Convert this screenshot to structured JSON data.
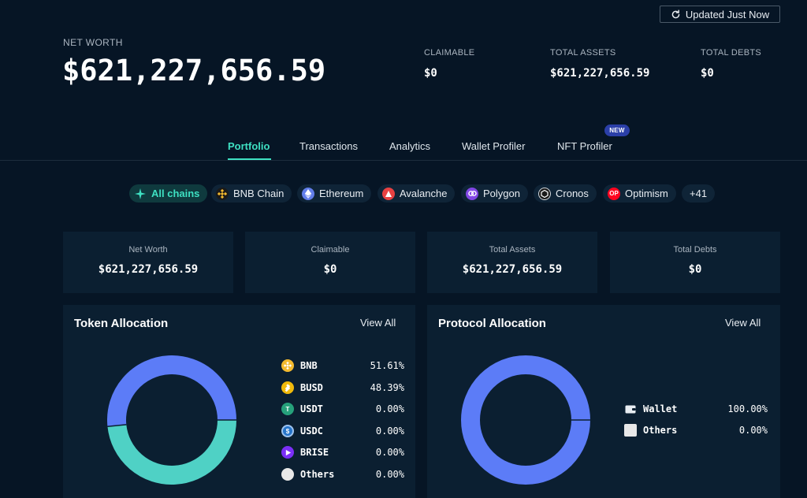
{
  "header": {
    "update_label": "Updated Just Now",
    "net_worth_label": "NET WORTH",
    "net_worth_value": "$621,227,656.59",
    "stats": [
      {
        "label": "CLAIMABLE",
        "value": "$0"
      },
      {
        "label": "TOTAL ASSETS",
        "value": "$621,227,656.59"
      },
      {
        "label": "TOTAL DEBTS",
        "value": "$0"
      }
    ]
  },
  "tabs": [
    {
      "label": "Portfolio",
      "active": true
    },
    {
      "label": "Transactions"
    },
    {
      "label": "Analytics"
    },
    {
      "label": "Wallet Profiler"
    },
    {
      "label": "NFT Profiler",
      "badge": "NEW"
    }
  ],
  "chains": [
    {
      "label": "All chains",
      "icon": "sparkle-icon",
      "active": true
    },
    {
      "label": "BNB Chain",
      "icon": "bnb-icon",
      "color": "#f3ba2f"
    },
    {
      "label": "Ethereum",
      "icon": "ethereum-icon",
      "color": "#627eea"
    },
    {
      "label": "Avalanche",
      "icon": "avalanche-icon",
      "color": "#e84142"
    },
    {
      "label": "Polygon",
      "icon": "polygon-icon",
      "color": "#8247e5"
    },
    {
      "label": "Cronos",
      "icon": "cronos-icon",
      "color": "#ffffff"
    },
    {
      "label": "Optimism",
      "icon": "optimism-icon",
      "color": "#ff0420",
      "icon_text": "OP"
    },
    {
      "label": "+41"
    }
  ],
  "cards": [
    {
      "label": "Net Worth",
      "value": "$621,227,656.59"
    },
    {
      "label": "Claimable",
      "value": "$0"
    },
    {
      "label": "Total Assets",
      "value": "$621,227,656.59"
    },
    {
      "label": "Total Debts",
      "value": "$0"
    }
  ],
  "token_allocation": {
    "title": "Token Allocation",
    "view_all": "View All",
    "items": [
      {
        "name": "BNB",
        "pct": "51.61%",
        "value": 51.61,
        "color": "#5c7cf7",
        "icon": "bnb-icon",
        "icon_color": "#f3ba2f"
      },
      {
        "name": "BUSD",
        "pct": "48.39%",
        "value": 48.39,
        "color": "#4fd1c5",
        "icon": "busd-icon",
        "icon_color": "#f0b90b"
      },
      {
        "name": "USDT",
        "pct": "0.00%",
        "value": 0,
        "icon": "usdt-icon",
        "icon_color": "#26a17b",
        "icon_text": "T"
      },
      {
        "name": "USDC",
        "pct": "0.00%",
        "value": 0,
        "icon": "usdc-icon",
        "icon_color": "#2775ca",
        "icon_text": "$"
      },
      {
        "name": "BRISE",
        "pct": "0.00%",
        "value": 0,
        "icon": "brise-icon",
        "icon_color": "#7b2ff7"
      },
      {
        "name": "Others",
        "pct": "0.00%",
        "value": 0,
        "icon": "others-icon",
        "icon_color": "#e8e8e8"
      }
    ]
  },
  "protocol_allocation": {
    "title": "Protocol Allocation",
    "view_all": "View All",
    "items": [
      {
        "name": "Wallet",
        "pct": "100.00%",
        "value": 100,
        "color": "#5c7cf7",
        "icon": "wallet-icon"
      },
      {
        "name": "Others",
        "pct": "0.00%",
        "value": 0,
        "icon": "others-icon",
        "icon_color": "#e8e8e8"
      }
    ]
  }
}
